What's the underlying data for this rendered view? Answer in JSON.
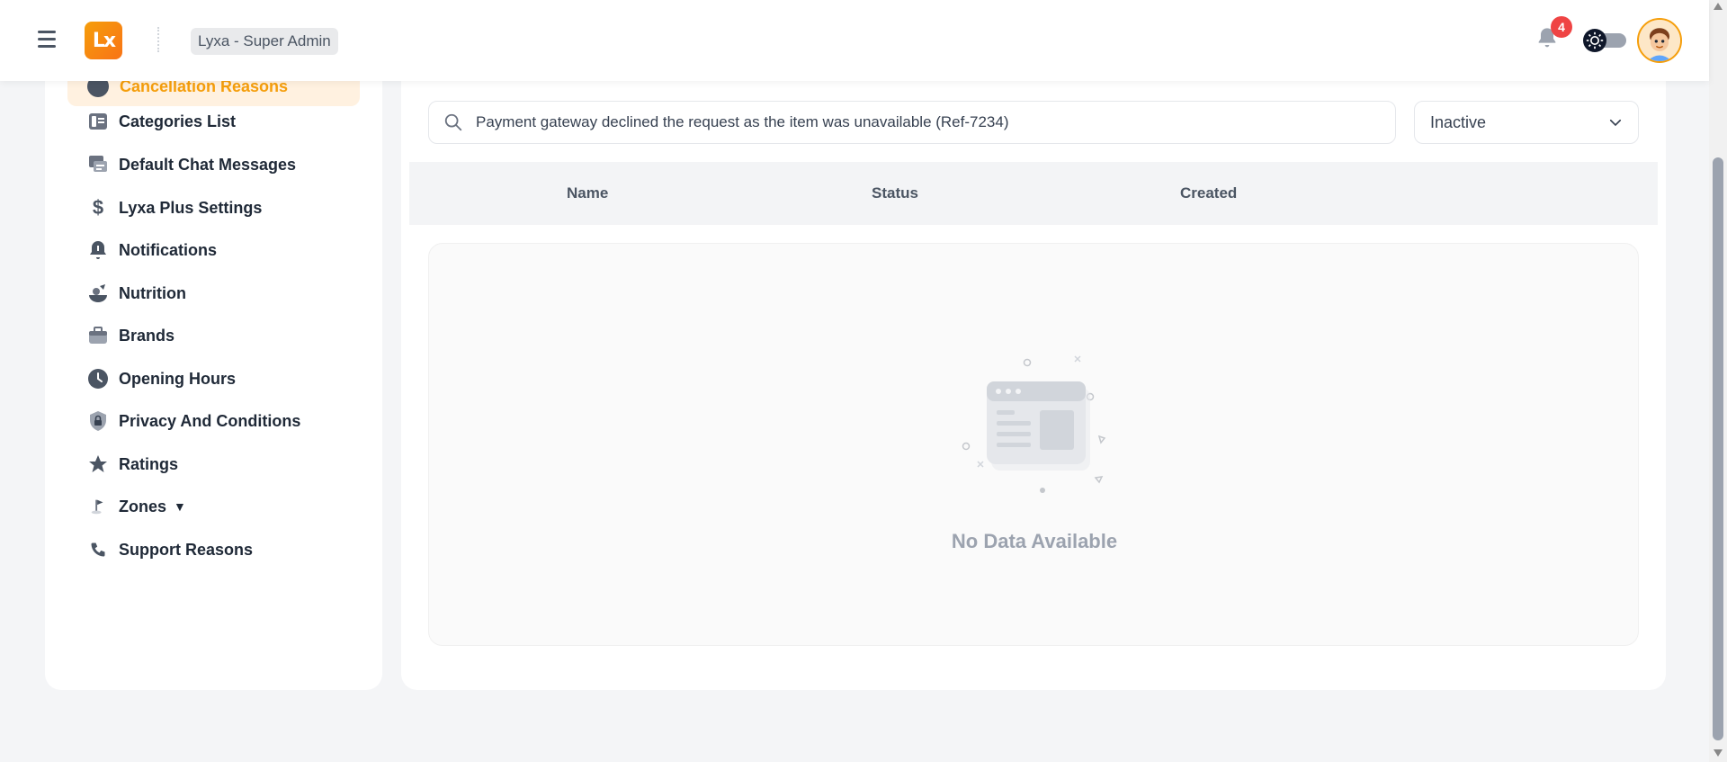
{
  "header": {
    "logo_text": "Lx",
    "role_label": "Lyxa - Super Admin",
    "notification_count": "4"
  },
  "sidebar": {
    "active_item": "Cancellation Reasons",
    "items": [
      {
        "label": "Categories List",
        "icon": "categories-icon"
      },
      {
        "label": "Default Chat Messages",
        "icon": "chat-icon"
      },
      {
        "label": "Lyxa Plus Settings",
        "icon": "dollar-icon"
      },
      {
        "label": "Notifications",
        "icon": "bell-icon"
      },
      {
        "label": "Nutrition",
        "icon": "nutrition-icon"
      },
      {
        "label": "Brands",
        "icon": "briefcase-icon"
      },
      {
        "label": "Opening Hours",
        "icon": "clock-icon"
      },
      {
        "label": "Privacy And Conditions",
        "icon": "lock-icon"
      },
      {
        "label": "Ratings",
        "icon": "star-icon"
      },
      {
        "label": "Zones",
        "icon": "flag-icon"
      },
      {
        "label": "Support Reasons",
        "icon": "phone-icon"
      }
    ],
    "zones_caret": "▼"
  },
  "main": {
    "search_value": "Payment gateway declined the request as the item was unavailable (Ref-7234)",
    "status_filter": "Inactive",
    "columns": [
      "Name",
      "Status",
      "Created"
    ],
    "empty_message": "No Data Available"
  },
  "colors": {
    "accent": "#f59e0b",
    "active_bg": "#fff1e0",
    "badge": "#ef4444"
  }
}
